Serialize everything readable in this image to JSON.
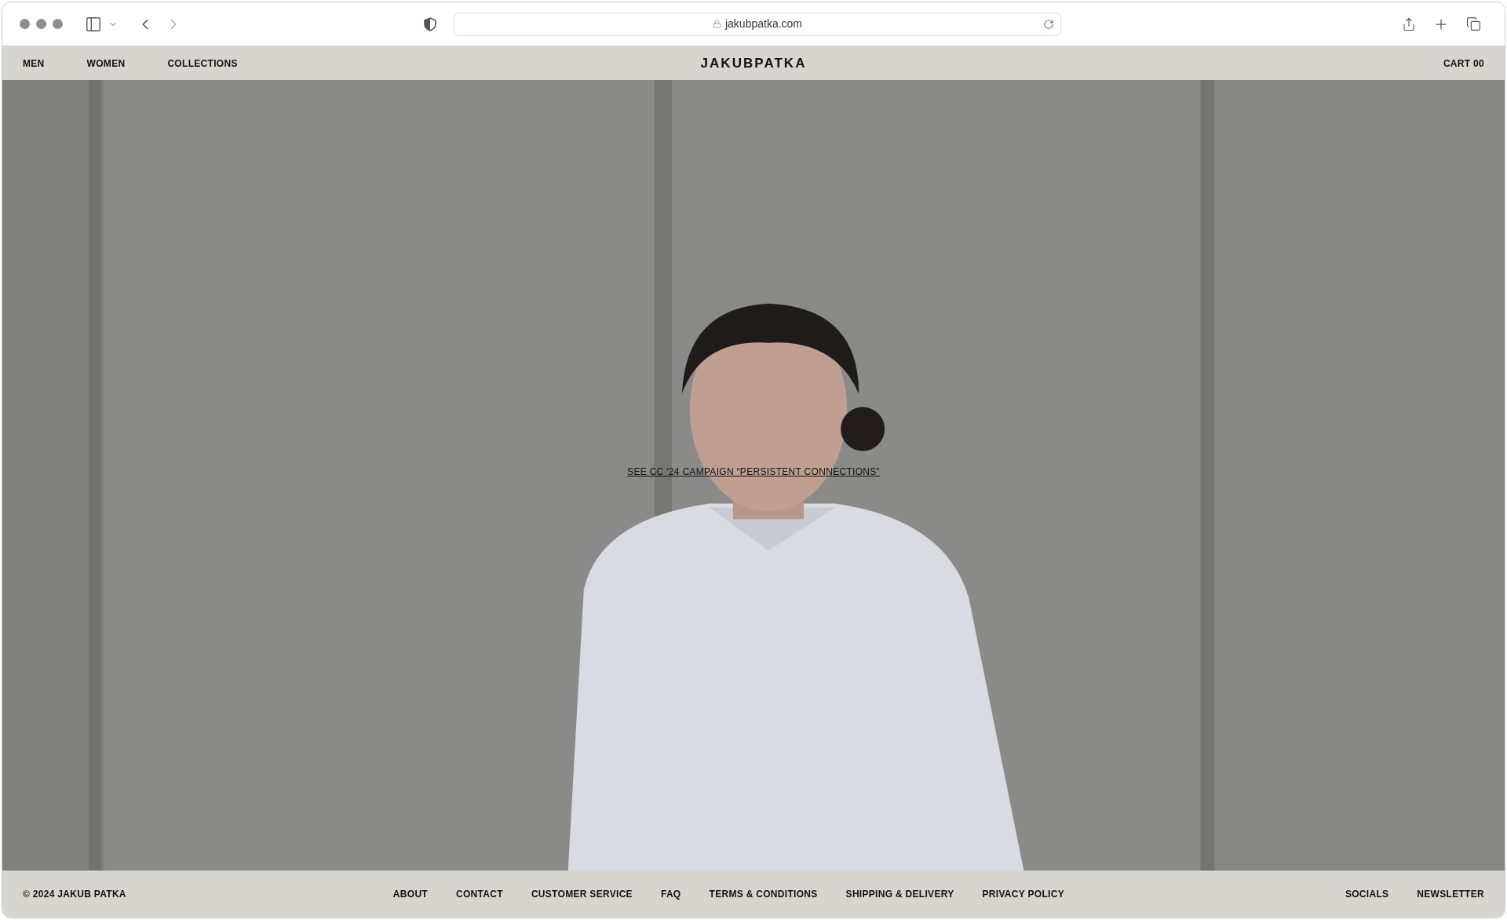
{
  "browser": {
    "url": "jakubpatka.com"
  },
  "nav": {
    "left": [
      "MEN",
      "WOMEN",
      "COLLECTIONS"
    ],
    "logo": "JAKUBPATKA",
    "cart": "CART 00"
  },
  "hero": {
    "link": "SEE CC '24 CAMPAIGN “PERSISTENT CONNECTIONS”"
  },
  "footer": {
    "copyright": "© 2024 JAKUB PATKA",
    "links": [
      "ABOUT",
      "CONTACT",
      "CUSTOMER SERVICE",
      "FAQ",
      "TERMS & CONDITIONS",
      "SHIPPING & DELIVERY",
      "PRIVACY POLICY"
    ],
    "right": [
      "SOCIALS",
      "NEWSLETTER"
    ]
  }
}
